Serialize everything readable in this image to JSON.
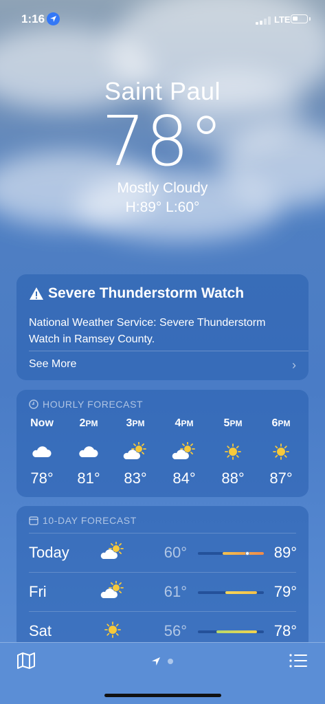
{
  "status_bar": {
    "time": "1:16",
    "network": "LTE",
    "location_icon": "location-arrow-icon",
    "battery_level": 0.3
  },
  "current": {
    "city": "Saint Paul",
    "temperature": "78°",
    "condition": "Mostly Cloudy",
    "high_low": "H:89°  L:60°"
  },
  "alert": {
    "title": "Severe Thunderstorm Watch",
    "body": "National Weather Service: Severe Thunderstorm Watch in Ramsey County.",
    "see_more": "See More",
    "icon": "warning-triangle-icon"
  },
  "hourly": {
    "header": "HOURLY FORECAST",
    "hours": [
      {
        "label": "Now",
        "icon": "cloud-icon",
        "temp": "78°"
      },
      {
        "label": "2PM",
        "icon": "cloud-icon",
        "temp": "81°"
      },
      {
        "label": "3PM",
        "icon": "partly-sunny-icon",
        "temp": "83°"
      },
      {
        "label": "4PM",
        "icon": "partly-sunny-icon",
        "temp": "84°"
      },
      {
        "label": "5PM",
        "icon": "sun-icon",
        "temp": "88°"
      },
      {
        "label": "6PM",
        "icon": "sun-icon",
        "temp": "87°"
      }
    ]
  },
  "ten_day": {
    "header": "10-DAY FORECAST",
    "days": [
      {
        "name": "Today",
        "icon": "partly-sunny-icon",
        "low": "60°",
        "high": "89°",
        "range_start": 0.38,
        "range_end": 1.0,
        "current_marker": 0.75,
        "colors": [
          "#f2c14e",
          "#f08a4b"
        ]
      },
      {
        "name": "Fri",
        "icon": "partly-sunny-icon",
        "low": "61°",
        "high": "79°",
        "range_start": 0.42,
        "range_end": 0.9,
        "colors": [
          "#f6d65a",
          "#f3c04a"
        ]
      },
      {
        "name": "Sat",
        "icon": "sun-icon",
        "low": "56°",
        "high": "78°",
        "range_start": 0.28,
        "range_end": 0.9,
        "colors": [
          "#b8d96a",
          "#f3d24d"
        ]
      }
    ]
  },
  "bottom_bar": {
    "map_icon": "map-icon",
    "nav_icon": "location-arrow-icon",
    "list_icon": "list-icon"
  }
}
